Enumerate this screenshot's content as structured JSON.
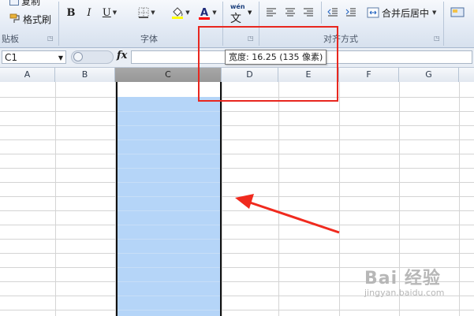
{
  "clipboard": {
    "copy_label": "复制",
    "format_painter_label": "格式刷",
    "group_label": "贴板"
  },
  "font": {
    "bold_label": "B",
    "italic_label": "I",
    "underline_label": "U",
    "group_label": "字体",
    "fill_color": "#ffff00",
    "font_color": "#ff0000"
  },
  "phonetic": {
    "top_label": "wén",
    "bottom_label": "文"
  },
  "alignment": {
    "merge_center_label": "合并后居中",
    "group_label": "对齐方式"
  },
  "formula_bar": {
    "name_box": "C1",
    "fx_label": "fx",
    "formula": ""
  },
  "tooltip": {
    "text": "宽度: 16.25 (135 像素)"
  },
  "grid": {
    "columns": [
      "A",
      "B",
      "C",
      "D",
      "E",
      "F",
      "G"
    ],
    "selected_column": "C"
  },
  "watermark": {
    "brand": "Bai 经验",
    "url": "jingyan.baidu.com"
  },
  "colors": {
    "highlight": "#e8271f",
    "selection": "#b5d5f8"
  }
}
